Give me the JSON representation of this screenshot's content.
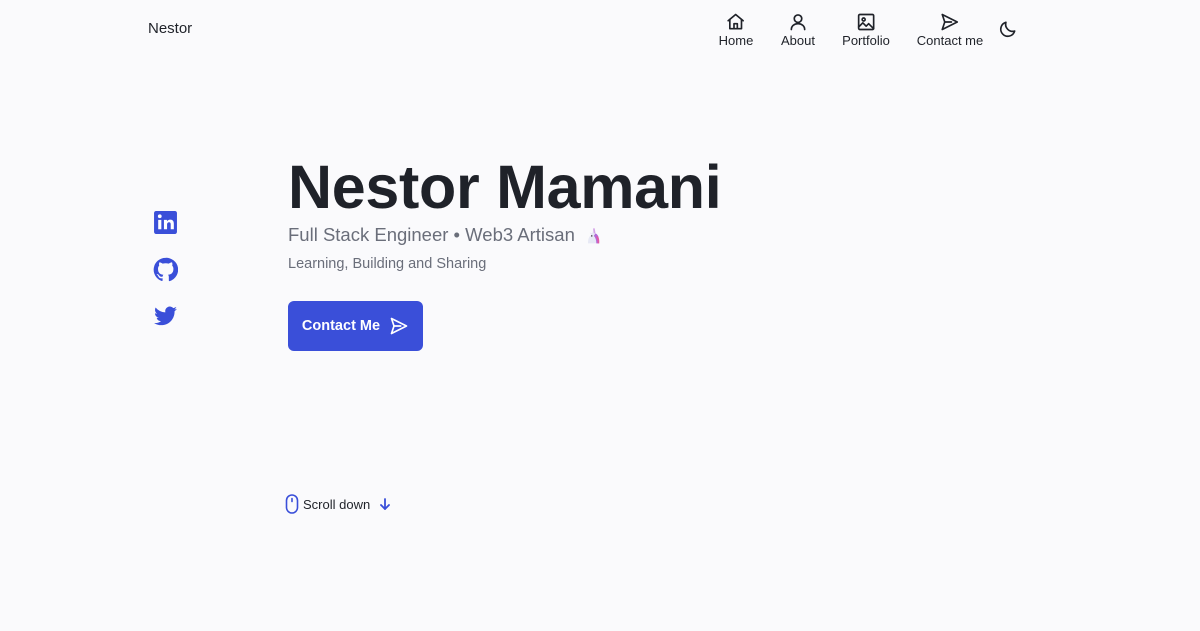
{
  "header": {
    "logo": "Nestor",
    "nav": [
      {
        "label": "Home",
        "icon": "home-icon"
      },
      {
        "label": "About",
        "icon": "user-icon"
      },
      {
        "label": "Portfolio",
        "icon": "image-icon"
      },
      {
        "label": "Contact me",
        "icon": "send-icon"
      }
    ],
    "theme_icon": "moon-icon"
  },
  "social": [
    {
      "icon": "linkedin-icon"
    },
    {
      "icon": "github-icon"
    },
    {
      "icon": "twitter-icon"
    }
  ],
  "hero": {
    "title": "Nestor Mamani",
    "subtitle": "Full Stack Engineer • Web3 Artisan",
    "subtitle_emoji": "unicorn-icon",
    "description": "Learning, Building and Sharing",
    "cta_label": "Contact Me",
    "cta_icon": "send-icon"
  },
  "scroll": {
    "label": "Scroll down",
    "icon": "mouse-icon",
    "arrow_icon": "arrow-down-icon"
  },
  "colors": {
    "accent": "#3a4fd9",
    "text": "#1f2229",
    "muted": "#6a6e7a",
    "background": "#fafafc"
  }
}
